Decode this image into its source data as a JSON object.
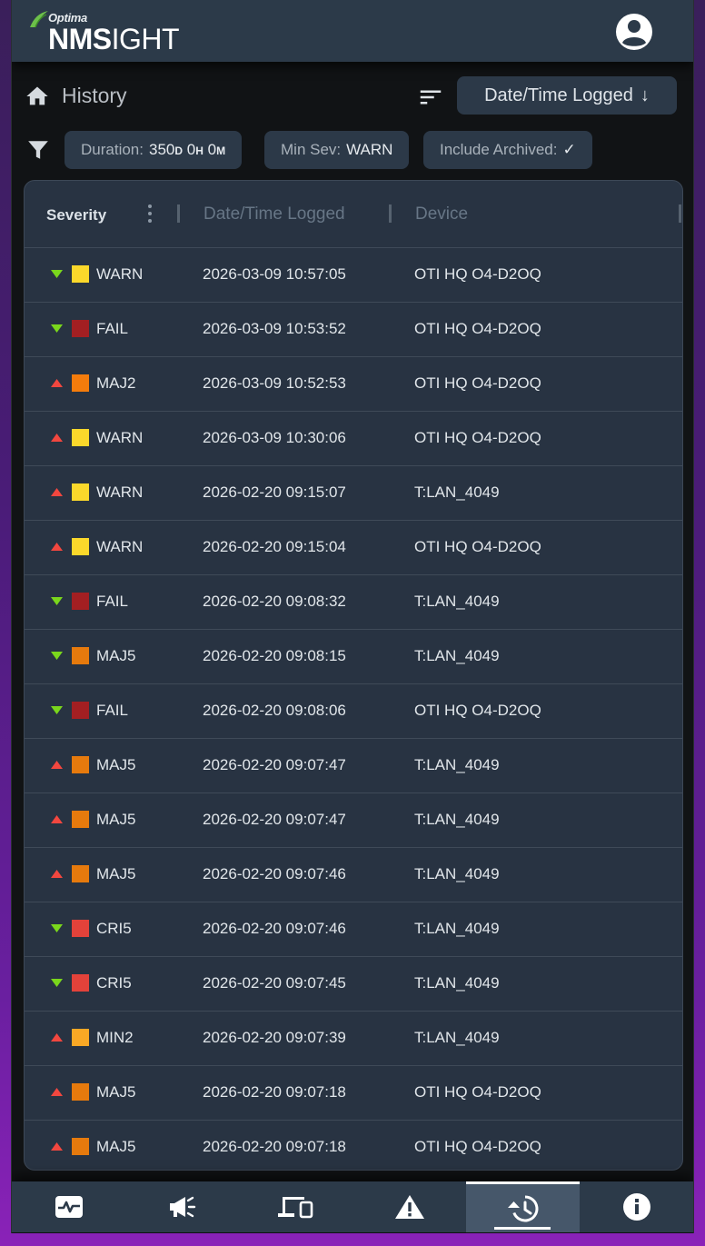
{
  "header": {
    "brand_small": "Optima",
    "brand_bold": "NMS",
    "brand_rest": "IGHT"
  },
  "titlebar": {
    "title": "History",
    "sort_label": "Date/Time Logged",
    "sort_arrow": "↓"
  },
  "filters": {
    "duration_label": "Duration:",
    "duration_d": "350",
    "duration_d_unit": "D",
    "duration_h": "0",
    "duration_h_unit": "H",
    "duration_m": "0",
    "duration_m_unit": "M",
    "minsev_label": "Min Sev:",
    "minsev_value": "WARN",
    "archived_label": "Include Archived:",
    "archived_value": "✓"
  },
  "table": {
    "columns": [
      "Severity",
      "Date/Time Logged",
      "Device"
    ],
    "rows": [
      {
        "dir": "down",
        "severity": "WARN",
        "color": "#fbd82b",
        "datetime": "2026-03-09 10:57:05",
        "device": "OTI HQ O4-D2OQ"
      },
      {
        "dir": "down",
        "severity": "FAIL",
        "color": "#a31f22",
        "datetime": "2026-03-09 10:53:52",
        "device": "OTI HQ O4-D2OQ"
      },
      {
        "dir": "up",
        "severity": "MAJ2",
        "color": "#f47c0c",
        "datetime": "2026-03-09 10:52:53",
        "device": "OTI HQ O4-D2OQ"
      },
      {
        "dir": "up",
        "severity": "WARN",
        "color": "#fbd82b",
        "datetime": "2026-03-09 10:30:06",
        "device": "OTI HQ O4-D2OQ"
      },
      {
        "dir": "up",
        "severity": "WARN",
        "color": "#fbd82b",
        "datetime": "2026-02-20 09:15:07",
        "device": "T:LAN_4049"
      },
      {
        "dir": "up",
        "severity": "WARN",
        "color": "#fbd82b",
        "datetime": "2026-02-20 09:15:04",
        "device": "OTI HQ O4-D2OQ"
      },
      {
        "dir": "down",
        "severity": "FAIL",
        "color": "#a31f22",
        "datetime": "2026-02-20 09:08:32",
        "device": "T:LAN_4049"
      },
      {
        "dir": "down",
        "severity": "MAJ5",
        "color": "#e67a0d",
        "datetime": "2026-02-20 09:08:15",
        "device": "T:LAN_4049"
      },
      {
        "dir": "down",
        "severity": "FAIL",
        "color": "#a31f22",
        "datetime": "2026-02-20 09:08:06",
        "device": "OTI HQ O4-D2OQ"
      },
      {
        "dir": "up",
        "severity": "MAJ5",
        "color": "#e67a0d",
        "datetime": "2026-02-20 09:07:47",
        "device": "T:LAN_4049"
      },
      {
        "dir": "up",
        "severity": "MAJ5",
        "color": "#e67a0d",
        "datetime": "2026-02-20 09:07:47",
        "device": "T:LAN_4049"
      },
      {
        "dir": "up",
        "severity": "MAJ5",
        "color": "#e67a0d",
        "datetime": "2026-02-20 09:07:46",
        "device": "T:LAN_4049"
      },
      {
        "dir": "down",
        "severity": "CRI5",
        "color": "#e3423a",
        "datetime": "2026-02-20 09:07:46",
        "device": "T:LAN_4049"
      },
      {
        "dir": "down",
        "severity": "CRI5",
        "color": "#e3423a",
        "datetime": "2026-02-20 09:07:45",
        "device": "T:LAN_4049"
      },
      {
        "dir": "up",
        "severity": "MIN2",
        "color": "#f9a825",
        "datetime": "2026-02-20 09:07:39",
        "device": "T:LAN_4049"
      },
      {
        "dir": "up",
        "severity": "MAJ5",
        "color": "#e67a0d",
        "datetime": "2026-02-20 09:07:18",
        "device": "OTI HQ O4-D2OQ"
      },
      {
        "dir": "up",
        "severity": "MAJ5",
        "color": "#e67a0d",
        "datetime": "2026-02-20 09:07:18",
        "device": "OTI HQ O4-D2OQ"
      }
    ]
  },
  "colors": {
    "arrow_up": "#f2473f",
    "arrow_down": "#7ad71c",
    "accent_bg": "#2c3948"
  },
  "bottomnav": {
    "items": [
      {
        "icon": "activity-monitor-icon",
        "active": false
      },
      {
        "icon": "announcement-icon",
        "active": false
      },
      {
        "icon": "devices-icon",
        "active": false
      },
      {
        "icon": "alarm-warning-icon",
        "active": false
      },
      {
        "icon": "history-icon",
        "active": true
      },
      {
        "icon": "info-icon",
        "active": false
      }
    ]
  }
}
